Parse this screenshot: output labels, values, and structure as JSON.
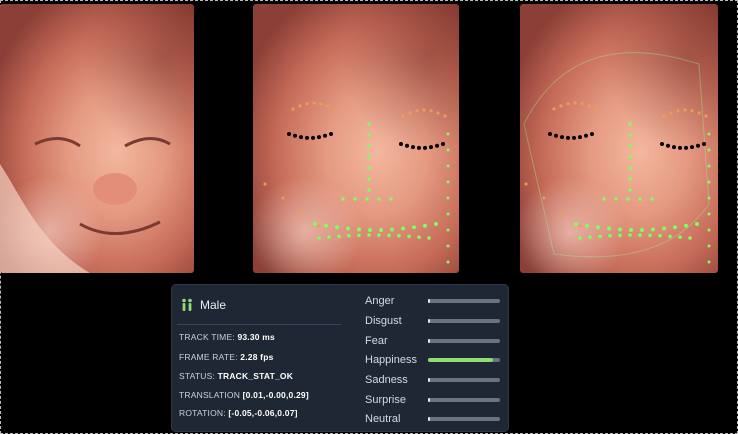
{
  "panel": {
    "gender": "Male",
    "stats": [
      {
        "label": "TRACK TIME:",
        "value": "93.30 ms"
      },
      {
        "label": "FRAME RATE:",
        "value": "2.28 fps"
      },
      {
        "label": "STATUS:",
        "value": "TRACK_STAT_OK"
      },
      {
        "label": "TRANSLATION",
        "value": "[0.01,-0.00,0.29]"
      },
      {
        "label": "ROTATION:",
        "value": "[-0.05,-0.06,0.07]"
      }
    ],
    "emotions": [
      {
        "label": "Anger",
        "level": 0.0
      },
      {
        "label": "Disgust",
        "level": 0.03
      },
      {
        "label": "Fear",
        "level": 0.0
      },
      {
        "label": "Happiness",
        "level": 0.9
      },
      {
        "label": "Sadness",
        "level": 0.02
      },
      {
        "label": "Surprise",
        "level": 0.0
      },
      {
        "label": "Neutral",
        "level": 0.02
      }
    ]
  },
  "colors": {
    "panel_bg": "#1e2733",
    "happiness_fill": "#8ddf73",
    "track_bg": "#6a7480",
    "landmark_green": "#7dff5e",
    "landmark_orange": "#f09a5a",
    "landmark_black": "#000000"
  },
  "icons": {
    "gender": "male-figures-icon"
  }
}
